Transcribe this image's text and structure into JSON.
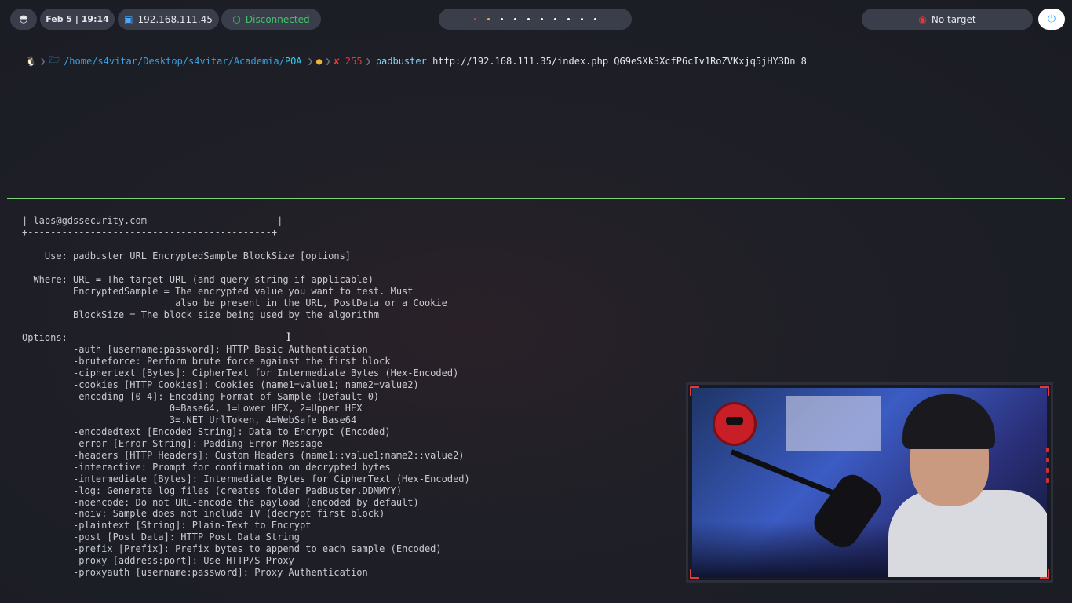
{
  "topbar": {
    "date_time": "Feb 5 | 19:14",
    "ip": "192.168.111.45",
    "vpn_status": "Disconnected",
    "target": "No target",
    "workspace_count": 10
  },
  "prompt": {
    "os_icon": "linux-icon",
    "path": "/home/s4vitar/Desktop/s4vitar/Academia/",
    "dir": "POA",
    "status": "✘ 255",
    "command_keyword": "padbuster",
    "command_args": "http://192.168.111.35/index.php QG9eSXk3XcfP6cIv1RoZVKxjq5jHY3Dn 8"
  },
  "output_lines": [
    "| labs@gdssecurity.com                       |",
    "+-------------------------------------------+",
    "",
    "    Use: padbuster URL EncryptedSample BlockSize [options]",
    "",
    "  Where: URL = The target URL (and query string if applicable)",
    "         EncryptedSample = The encrypted value you want to test. Must",
    "                           also be present in the URL, PostData or a Cookie",
    "         BlockSize = The block size being used by the algorithm",
    "",
    "Options:",
    "         -auth [username:password]: HTTP Basic Authentication",
    "         -bruteforce: Perform brute force against the first block",
    "         -ciphertext [Bytes]: CipherText for Intermediate Bytes (Hex-Encoded)",
    "         -cookies [HTTP Cookies]: Cookies (name1=value1; name2=value2)",
    "         -encoding [0-4]: Encoding Format of Sample (Default 0)",
    "                          0=Base64, 1=Lower HEX, 2=Upper HEX",
    "                          3=.NET UrlToken, 4=WebSafe Base64",
    "         -encodedtext [Encoded String]: Data to Encrypt (Encoded)",
    "         -error [Error String]: Padding Error Message",
    "         -headers [HTTP Headers]: Custom Headers (name1::value1;name2::value2)",
    "         -interactive: Prompt for confirmation on decrypted bytes",
    "         -intermediate [Bytes]: Intermediate Bytes for CipherText (Hex-Encoded)",
    "         -log: Generate log files (creates folder PadBuster.DDMMYY)",
    "         -noencode: Do not URL-encode the payload (encoded by default)",
    "         -noiv: Sample does not include IV (decrypt first block)",
    "         -plaintext [String]: Plain-Text to Encrypt",
    "         -post [Post Data]: HTTP Post Data String",
    "         -prefix [Prefix]: Prefix bytes to append to each sample (Encoded)",
    "         -proxy [address:port]: Use HTTP/S Proxy",
    "         -proxyauth [username:password]: Proxy Authentication"
  ],
  "colors": {
    "divider": "#7fd07a",
    "disconnected": "#3ec36a",
    "error": "#e03a3a",
    "path": "#3aa0e0"
  }
}
